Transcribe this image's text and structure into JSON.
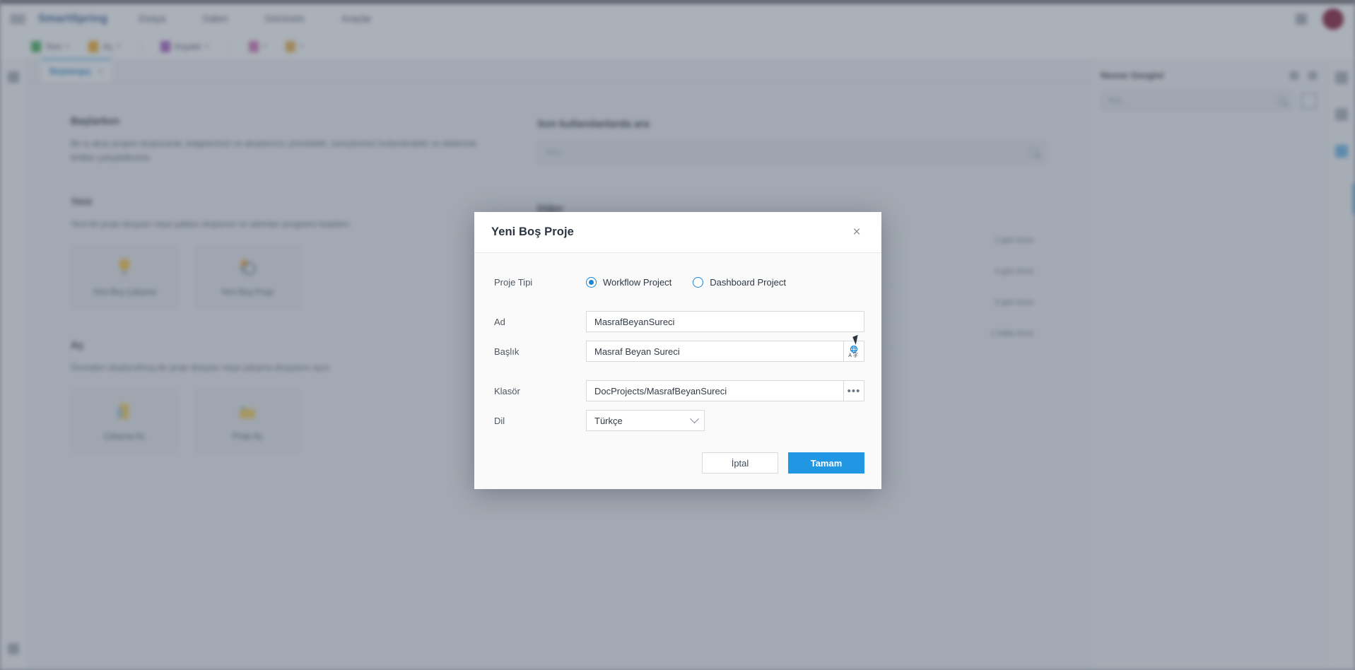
{
  "app": {
    "brand": "SmartSpring",
    "menu": [
      "Dosya",
      "Galeri",
      "Görünüm",
      "Araçlar"
    ],
    "ribbon": [
      {
        "label": "Yeni",
        "caret": "▾",
        "color": "#3aa657"
      },
      {
        "label": "Aç",
        "caret": "▾",
        "color": "#e0a126"
      },
      {
        "label": "Kaydet",
        "caret": "▾",
        "color": "#9a56b8"
      },
      {
        "label": "",
        "caret": "▾",
        "color": "#c06bb0"
      },
      {
        "label": "",
        "caret": "▾",
        "color": "#d8a44a"
      }
    ],
    "window_icons": [
      "minimize-icon",
      "maximize-icon"
    ],
    "avatar_color": "#7a1130"
  },
  "tabstrip": {
    "tab_label": "Başlangıç",
    "tab_close": "×"
  },
  "content": {
    "intro_heading": "Başlarken",
    "intro_text": "Bir iş akışı projesi oluşturarak, belgelerinizi ve akışlarınızı yönetebilir, süreçlerinizi hızlandırabilir ve ekibinizle birlikte çalışabilirsiniz.",
    "new_heading": "Yeni",
    "new_text": "Yeni bir proje dosyası veya şablon oluşturun ve adımları programı başlatın.",
    "new_tiles": [
      {
        "label": "Yeni Boş Çalışma",
        "icon": "bulb-icon"
      },
      {
        "label": "Yeni Boş Proje",
        "icon": "puzzle-icon"
      }
    ],
    "open_heading": "Aç",
    "open_text": "Önceden oluşturulmuş bir proje dosyası veya çalışma dosyasını açın.",
    "open_tiles": [
      {
        "label": "Çalışma Aç",
        "icon": "folder-doc-icon"
      },
      {
        "label": "Proje Aç",
        "icon": "folder-open-icon"
      }
    ],
    "search_heading": "Son kullanılanlarda ara",
    "search_placeholder": "Ara...",
    "recent_heading": "Diğer",
    "recent_rows": [
      {
        "timestamp": "2 gün önce"
      },
      {
        "timestamp": "3 gün önce"
      },
      {
        "timestamp": "5 gün önce"
      },
      {
        "timestamp": "1 hafta önce"
      }
    ]
  },
  "rightpanel": {
    "title": "Nesne Gezgini",
    "search_placeholder": "Ara...",
    "actions": [
      "grid-icon",
      "more-icon"
    ],
    "grid_button": "grid-view-icon"
  },
  "iconrail": {
    "items": [
      "properties-icon",
      "layers-icon",
      "explorer-icon"
    ]
  },
  "modal": {
    "title": "Yeni Boş Proje",
    "close_label": "×",
    "accent": "#2196e3",
    "fields": {
      "project_type_label": "Proje Tipi",
      "project_type_options": [
        {
          "label": "Workflow Project",
          "selected": true
        },
        {
          "label": "Dashboard Project",
          "selected": false
        }
      ],
      "name_label": "Ad",
      "name_value": "MasrafBeyanSureci",
      "title_label": "Başlık",
      "title_value": "Masraf Beyan Sureci",
      "title_addon_icon": "translate-globe-icon",
      "folder_label": "Klasör",
      "folder_value": "DocProjects/MasrafBeyanSureci",
      "folder_addon_label": "•••",
      "language_label": "Dil",
      "language_value": "Türkçe"
    },
    "cancel_label": "İptal",
    "ok_label": "Tamam"
  }
}
